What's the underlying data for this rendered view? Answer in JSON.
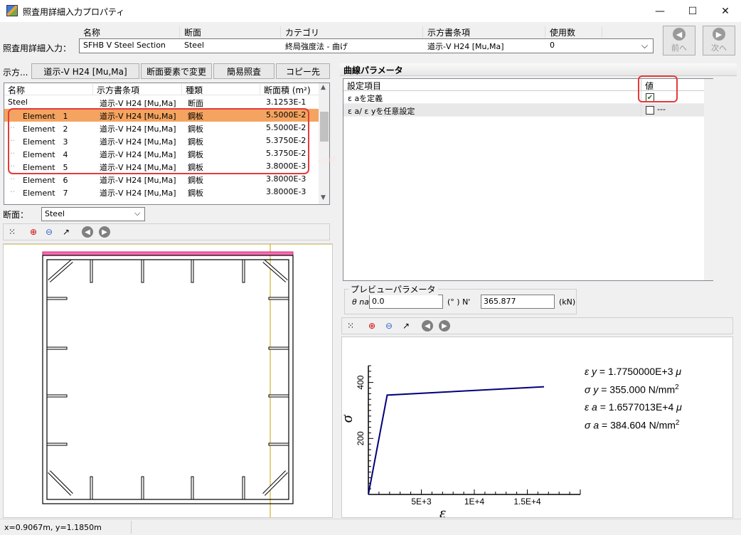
{
  "window": {
    "title": "照査用詳細入力プロパティ",
    "min_glyph": "—",
    "max_glyph": "☐",
    "close_glyph": "✕"
  },
  "top": {
    "label": "照査用詳細入力：",
    "headers": [
      "名称",
      "断面",
      "カテゴリ",
      "示方書条項",
      "使用数"
    ],
    "values": [
      "SFHB V Steel Section",
      "Steel",
      "終局強度法 - 曲げ",
      "道示-V H24 [Mu,Ma]",
      "0"
    ],
    "prev_label": "前へ",
    "next_label": "次へ"
  },
  "left": {
    "tabs_label": "示方...",
    "buttons": [
      "道示-V H24 [Mu,Ma]",
      "断面要素で変更",
      "簡易照査",
      "コピー先"
    ],
    "grid": {
      "headers": [
        "名称",
        "示方書条項",
        "種類",
        "断面積 (m²)"
      ],
      "rows": [
        {
          "name": "Steel",
          "code": "道示-V H24 [Mu,Ma]",
          "kind": "断面",
          "area": "3.1253E-1",
          "selected": false,
          "child": false
        },
        {
          "name": "Element　1",
          "code": "道示-V H24 [Mu,Ma]",
          "kind": "鋼板",
          "area": "5.5000E-2",
          "selected": true,
          "child": true
        },
        {
          "name": "Element　2",
          "code": "道示-V H24 [Mu,Ma]",
          "kind": "鋼板",
          "area": "5.5000E-2",
          "selected": false,
          "child": true
        },
        {
          "name": "Element　3",
          "code": "道示-V H24 [Mu,Ma]",
          "kind": "鋼板",
          "area": "5.3750E-2",
          "selected": false,
          "child": true
        },
        {
          "name": "Element　4",
          "code": "道示-V H24 [Mu,Ma]",
          "kind": "鋼板",
          "area": "5.3750E-2",
          "selected": false,
          "child": true
        },
        {
          "name": "Element　5",
          "code": "道示-V H24 [Mu,Ma]",
          "kind": "鋼板",
          "area": "3.8000E-3",
          "selected": false,
          "child": true
        },
        {
          "name": "Element　6",
          "code": "道示-V H24 [Mu,Ma]",
          "kind": "鋼板",
          "area": "3.8000E-3",
          "selected": false,
          "child": true
        },
        {
          "name": "Element　7",
          "code": "道示-V H24 [Mu,Ma]",
          "kind": "鋼板",
          "area": "3.8000E-3",
          "selected": false,
          "child": true
        }
      ]
    },
    "section_label": "断面：",
    "section_value": "Steel",
    "status": "x=0.9067m, y=1.1850m"
  },
  "right": {
    "curve_title": "曲線パラメータ",
    "param_headers": [
      "設定項目",
      "値"
    ],
    "params": [
      {
        "name": "ε aを定義",
        "checked": true,
        "extra": ""
      },
      {
        "name": "ε a/ ε yを任意設定",
        "checked": false,
        "extra": "---"
      }
    ],
    "preview_title": "プレビューパラメータ",
    "theta_label": "θ na",
    "theta_value": "0.0",
    "deg_label": "(° ) N'",
    "n_value": "365.877",
    "unit_kN": "(kN)"
  },
  "chart_data": {
    "type": "line",
    "xlabel": "ε",
    "ylabel": "σ",
    "xlim": [
      0,
      20000
    ],
    "ylim": [
      0,
      460
    ],
    "xticks": [
      5000,
      10000,
      15000
    ],
    "xtick_labels": [
      "5E+3",
      "1E+4",
      "1.5E+4"
    ],
    "yticks": [
      200,
      400
    ],
    "ytick_labels": [
      "200",
      "400"
    ],
    "series": [
      {
        "x": [
          0,
          1775,
          16577
        ],
        "y": [
          0,
          355,
          384.604
        ]
      }
    ],
    "annotations": [
      {
        "sym": "ε y",
        "text": " = 1.7750000E+3 ",
        "unit": "μ"
      },
      {
        "sym": "σ y",
        "text": " = 355.000 N/mm",
        "unit": "2"
      },
      {
        "sym": "ε a",
        "text": " = 1.6577013E+4 ",
        "unit": "μ"
      },
      {
        "sym": "σ a",
        "text": " = 384.604 N/mm",
        "unit": "2"
      }
    ],
    "line_color": "#00007a"
  },
  "colors": {
    "selection": "#f4a460",
    "highlight": "#e43a3a",
    "section_line": "#000000",
    "top_flange": "#ff69b4",
    "guide_line": "#c8a000"
  }
}
